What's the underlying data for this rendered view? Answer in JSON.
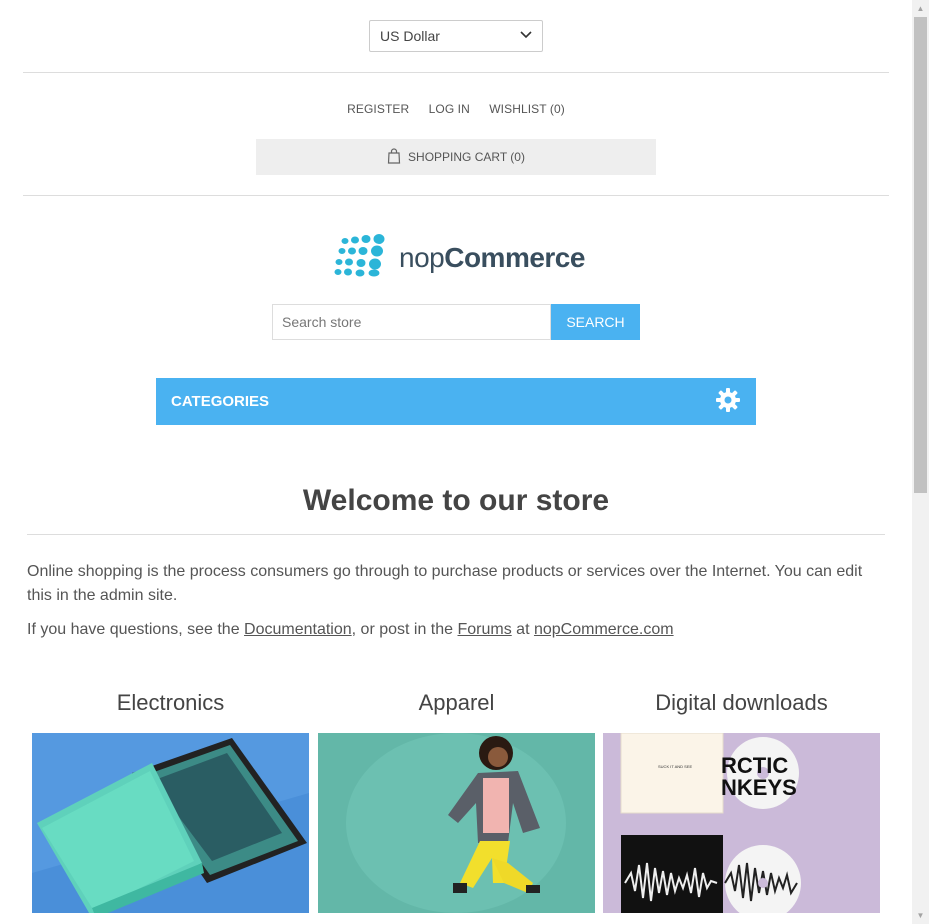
{
  "currency": {
    "selected": "US Dollar"
  },
  "header_links": {
    "register": "REGISTER",
    "login": "LOG IN",
    "wishlist": "WISHLIST (0)"
  },
  "cart": {
    "label": "SHOPPING CART (0)"
  },
  "logo": {
    "light": "nop",
    "bold": "Commerce"
  },
  "search": {
    "placeholder": "Search store",
    "button": "SEARCH"
  },
  "categories_bar": {
    "label": "CATEGORIES"
  },
  "welcome": {
    "title": "Welcome to our store",
    "p1": "Online shopping is the process consumers go through to purchase products or services over the Internet. You can edit this in the admin site.",
    "p2_pre": "If you have questions, see the ",
    "p2_doc": "Documentation",
    "p2_mid": ", or post in the ",
    "p2_forums": "Forums",
    "p2_at": " at ",
    "p2_site": "nopCommerce.com"
  },
  "home_categories": [
    {
      "name": "Electronics"
    },
    {
      "name": "Apparel"
    },
    {
      "name": "Digital downloads"
    }
  ],
  "colors": {
    "accent": "#4ab2f1",
    "logo_dots": "#2bb5d8",
    "logo_text": "#394e5e"
  }
}
